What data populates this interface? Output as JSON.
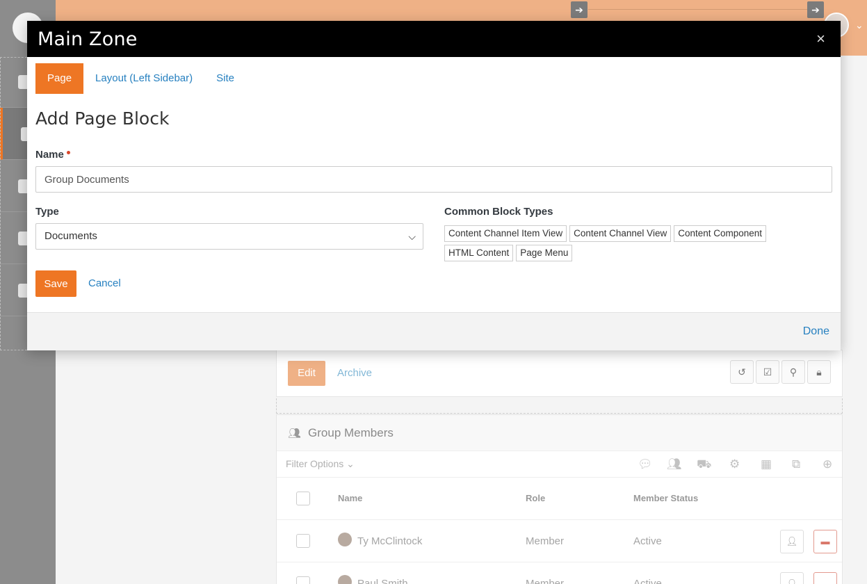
{
  "modal": {
    "title": "Main Zone",
    "close_glyph": "×",
    "tabs": [
      {
        "label": "Page",
        "active": true
      },
      {
        "label": "Layout (Left Sidebar)",
        "active": false
      },
      {
        "label": "Site",
        "active": false
      }
    ],
    "section_title": "Add Page Block",
    "name_label": "Name",
    "name_value": "Group Documents",
    "type_label": "Type",
    "type_value": "Documents",
    "common_label": "Common Block Types",
    "common_types": [
      "Content Channel Item View",
      "Content Channel View",
      "Content Component",
      "HTML Content",
      "Page Menu"
    ],
    "save_label": "Save",
    "cancel_label": "Cancel",
    "done_label": "Done"
  },
  "background": {
    "edit_label": "Edit",
    "archive_label": "Archive",
    "members_title": "Group Members",
    "filter_label": "Filter Options",
    "columns": [
      "Name",
      "Role",
      "Member Status"
    ],
    "rows": [
      {
        "name": "Ty McClintock",
        "role": "Member",
        "status": "Active"
      },
      {
        "name": "Paul Smith",
        "role": "Member",
        "status": "Active"
      }
    ]
  },
  "colors": {
    "accent": "#ee7624",
    "link": "#2680c0",
    "header_bg": "#000000",
    "topbar": "#efb186"
  }
}
